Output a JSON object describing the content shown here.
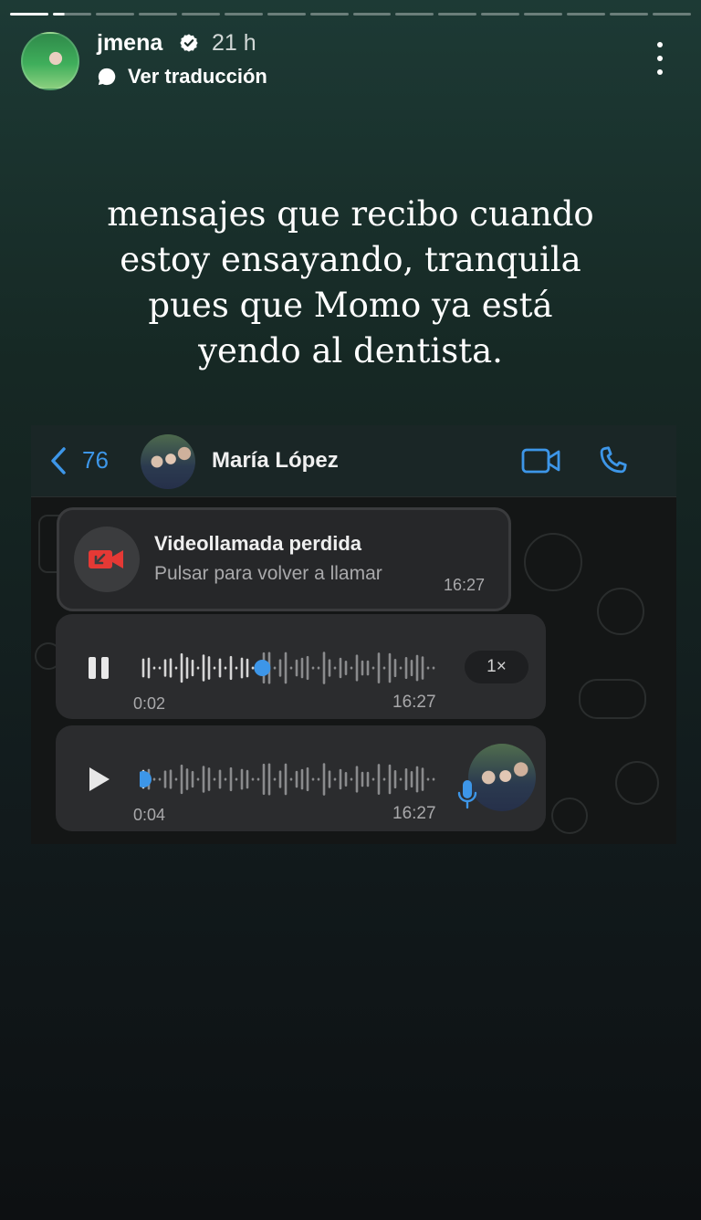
{
  "story": {
    "segments": 16,
    "completed_segments": 1,
    "current_segment_fraction": 0.3
  },
  "header": {
    "username": "jmena",
    "time": "21 h",
    "translate_label": "Ver traducción",
    "verified_icon": "verified-badge-icon",
    "more_icon": "more-vertical-icon"
  },
  "caption": {
    "lines": [
      "mensajes que recibo cuando",
      "estoy ensayando, tranquila",
      "pues que Momo ya está",
      "yendo al dentista."
    ]
  },
  "screenshot": {
    "back_count": "76",
    "contact_name": "María López",
    "accent_color": "#3d96e8",
    "missed_call": {
      "title": "Videollamada perdida",
      "subtitle": "Pulsar para volver a llamar",
      "time": "16:27",
      "icon_color": "#e53935"
    },
    "voice_notes": [
      {
        "state": "playing",
        "elapsed": "0:02",
        "time": "16:27",
        "speed": "1×",
        "progress": 0.41
      },
      {
        "state": "paused",
        "elapsed": "0:04",
        "time": "16:27",
        "progress": 0.0
      }
    ]
  }
}
